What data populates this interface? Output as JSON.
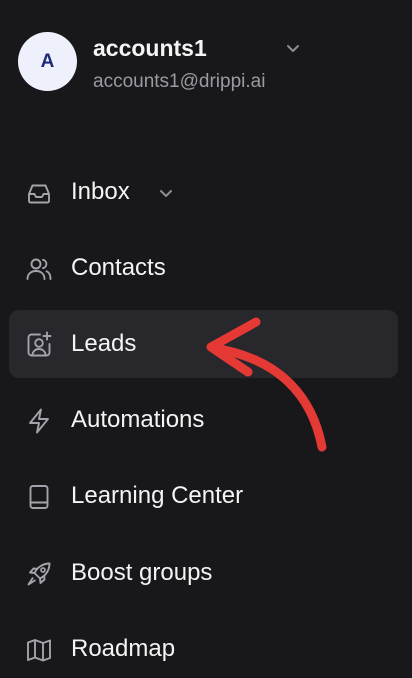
{
  "account": {
    "avatar_letter": "A",
    "name": "accounts1",
    "email": "accounts1@drippi.ai",
    "menu_icon": "chevron-down-icon"
  },
  "nav": {
    "items": [
      {
        "label": "Inbox",
        "icon": "inbox-icon",
        "has_submenu": true,
        "active": false
      },
      {
        "label": "Contacts",
        "icon": "users-icon",
        "active": false
      },
      {
        "label": "Leads",
        "icon": "user-plus-square-icon",
        "active": true
      },
      {
        "label": "Automations",
        "icon": "lightning-icon",
        "active": false
      },
      {
        "label": "Learning Center",
        "icon": "book-icon",
        "active": false
      },
      {
        "label": "Boost groups",
        "icon": "rocket-icon",
        "active": false
      },
      {
        "label": "Roadmap",
        "icon": "map-icon",
        "active": false
      }
    ]
  },
  "annotation": {
    "type": "curved-arrow",
    "color": "#e53935",
    "points_to": "Leads"
  },
  "colors": {
    "background": "#18181b",
    "active_item_bg": "#27272c",
    "text_primary": "#f4f4f5",
    "text_secondary": "#9a9aa3",
    "avatar_bg": "#eef0fb",
    "avatar_text": "#1f2a77"
  }
}
